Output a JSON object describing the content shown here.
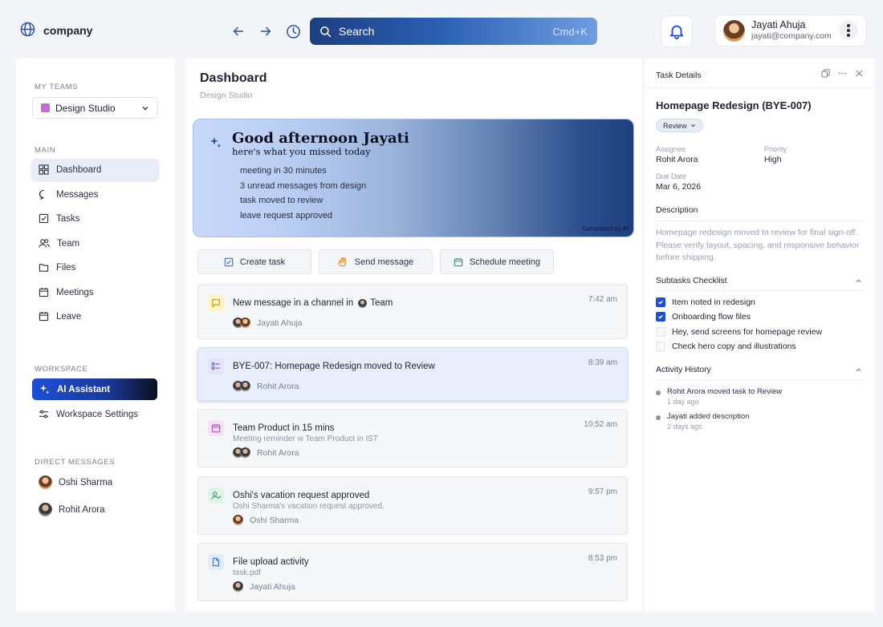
{
  "brand": {
    "name": "company"
  },
  "search": {
    "placeholder": "Search",
    "shortcut": "Cmd+K"
  },
  "user": {
    "name": "Jayati Ahuja",
    "email": "jayati@company.com"
  },
  "sidebar": {
    "my_teams_label": "MY TEAMS",
    "team_selected": "Design Studio",
    "team_color": "#c06bd6",
    "main_label": "MAIN",
    "items": [
      {
        "label": "Dashboard",
        "icon": "grid-icon",
        "active": true
      },
      {
        "label": "Messages",
        "icon": "message-icon"
      },
      {
        "label": "Tasks",
        "icon": "checkbox-icon"
      },
      {
        "label": "Team",
        "icon": "users-icon"
      },
      {
        "label": "Files",
        "icon": "folder-icon"
      },
      {
        "label": "Meetings",
        "icon": "calendar-icon"
      },
      {
        "label": "Leave",
        "icon": "calendar-icon"
      }
    ],
    "workspace_label": "WORKSPACE",
    "workspace_items": [
      {
        "label": "AI Assistant",
        "icon": "sparkle-icon"
      },
      {
        "label": "Workspace Settings",
        "icon": "settings-icon"
      }
    ],
    "dm_label": "DIRECT MESSAGES",
    "dms": [
      {
        "name": "Oshi Sharma"
      },
      {
        "name": "Rohit Arora"
      }
    ]
  },
  "main": {
    "title": "Dashboard",
    "subtitle": "Design Studio",
    "hero": {
      "title": "Good afternoon Jayati",
      "subtitle": "here's what you missed today",
      "items": [
        "meeting in 30 minutes",
        "3 unread messages from design",
        "task moved to review",
        "leave request approved"
      ],
      "tag": "Generated by AI"
    },
    "quick_actions": [
      {
        "label": "Create task",
        "icon": "checkbox-icon"
      },
      {
        "label": "Send message",
        "icon": "hand-icon"
      },
      {
        "label": "Schedule meeting",
        "icon": "calendar-icon"
      }
    ],
    "feed": [
      {
        "title": "New message in a channel in",
        "title_suffix": "Team",
        "subtitle": "",
        "time": "7:42 am",
        "person": "Jayati Ahuja",
        "icon": "message-icon",
        "icon_bg": "#fdf3c4",
        "icon_color": "#c79a10"
      },
      {
        "title": "BYE-007: Homepage Redesign moved to Review",
        "title_suffix": "",
        "subtitle": "",
        "time": "8:39 am",
        "person": "Rohit Arora",
        "icon": "list-icon",
        "icon_bg": "#e4e2f6",
        "icon_color": "#6b5fc4",
        "selected": true
      },
      {
        "title": "Team Product in 15 mins",
        "title_suffix": "",
        "subtitle": "Meeting reminder w Team Product in IST",
        "time": "10:52 am",
        "person": "Rohit Arora",
        "icon": "calendar-icon",
        "icon_bg": "#f6e2f4",
        "icon_color": "#b04fb0"
      },
      {
        "title": "Oshi's vacation request approved",
        "title_suffix": "",
        "subtitle": "Oshi Sharma's vacation request approved.",
        "time": "9:57 pm",
        "person": "Oshi Sharma",
        "icon": "user-check-icon",
        "icon_bg": "#dff4e8",
        "icon_color": "#2f9d63"
      },
      {
        "title": "File upload activity",
        "title_suffix": "",
        "subtitle": "task.pdf",
        "time": "8:53 pm",
        "person": "Jayati Ahuja",
        "icon": "file-icon",
        "icon_bg": "#e1ebfb",
        "icon_color": "#3a6fd8"
      }
    ]
  },
  "panel": {
    "header": "Task Details",
    "title": "Homepage Redesign (BYE-007)",
    "status": "Review",
    "assignee_label": "Assignee",
    "assignee": "Rohit Arora",
    "priority_label": "Priority",
    "priority": "High",
    "due_label": "Due Date",
    "due": "Mar 6, 2026",
    "description_label": "Description",
    "description": "Homepage redesign moved to review for final sign-off. Please verify layout, spacing, and responsive behavior before shipping.",
    "subtasks_label": "Subtasks Checklist",
    "subtasks": [
      {
        "label": "Item noted in redesign",
        "checked": true
      },
      {
        "label": "Onboarding flow files",
        "checked": true
      },
      {
        "label": "Hey, send screens for homepage review",
        "checked": false
      },
      {
        "label": "Check hero copy and illustrations",
        "checked": false
      }
    ],
    "activity_label": "Activity History",
    "activity": [
      {
        "text": "Rohit Arora moved task to Review",
        "ago": "1 day ago"
      },
      {
        "text": "Jayati added description",
        "ago": "2 days ago"
      }
    ]
  },
  "colors": {
    "accent": "#1d4ed8",
    "search_gradient_start": "#1d3f80",
    "hero_gradient_end": "#1f3f7d"
  }
}
